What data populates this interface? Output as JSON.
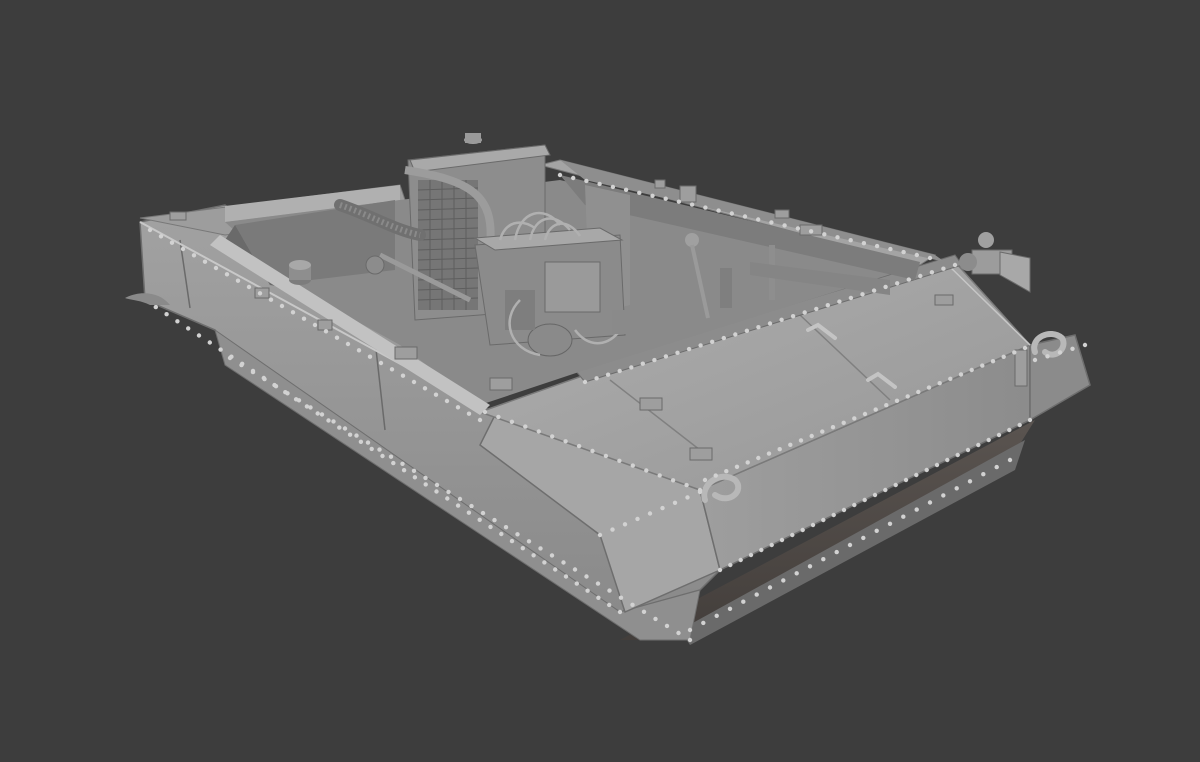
{
  "viewport": {
    "background": "#3d3d3d"
  },
  "model": {
    "subject": "armored-tracked-vehicle-hull-render",
    "palette": {
      "light": "#b4b4b4",
      "mid": "#9d9d9d",
      "dark": "#7d7d7d",
      "shadow": "#555555",
      "deep": "#3f3f3f",
      "highlight": "#cfcfcf"
    }
  }
}
